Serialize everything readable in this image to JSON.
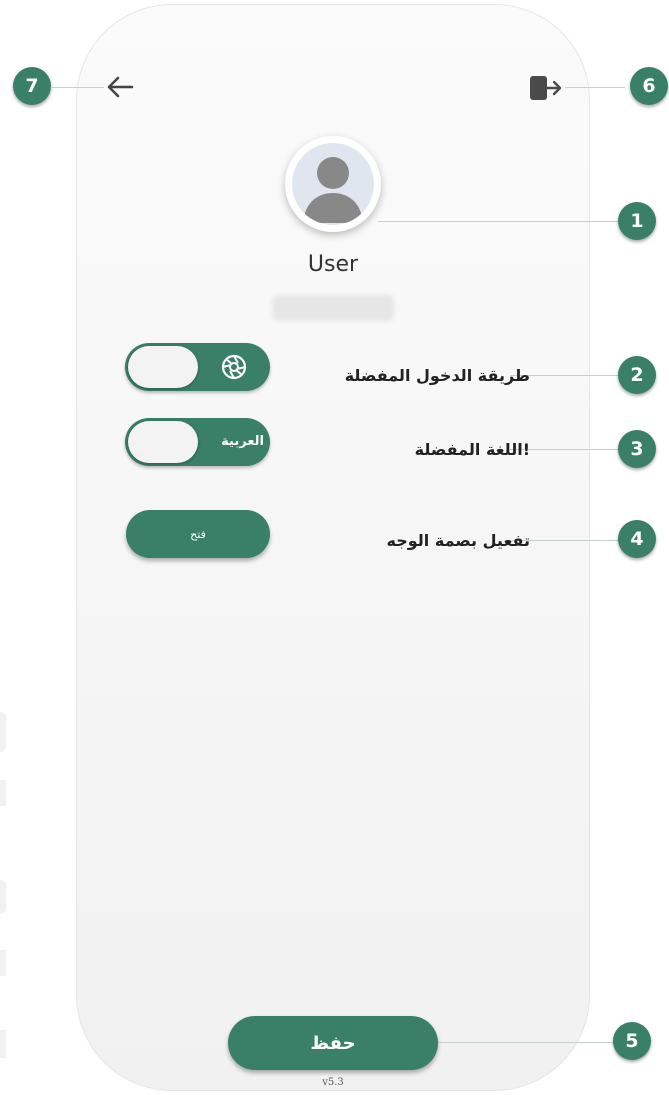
{
  "profile": {
    "user_name": "User",
    "avatar_icon": "user-avatar-icon"
  },
  "settings": {
    "login_method_label": "طريقة الدخول المفضلة",
    "login_method_icon": "camera-aperture-icon",
    "language_label": "!اللغة المفضلة",
    "language_value": "العربية",
    "face_id_label": "تفعيل بصمة الوجه",
    "face_id_button": "فتح"
  },
  "footer": {
    "save_label": "حفظ",
    "version": "v5.3"
  },
  "header": {
    "back_icon": "arrow-left-icon",
    "logout_icon": "logout-icon"
  },
  "annotations": [
    "1",
    "2",
    "3",
    "4",
    "5",
    "6",
    "7"
  ],
  "colors": {
    "accent": "#3a7f68",
    "background": "#f4f4f4"
  }
}
